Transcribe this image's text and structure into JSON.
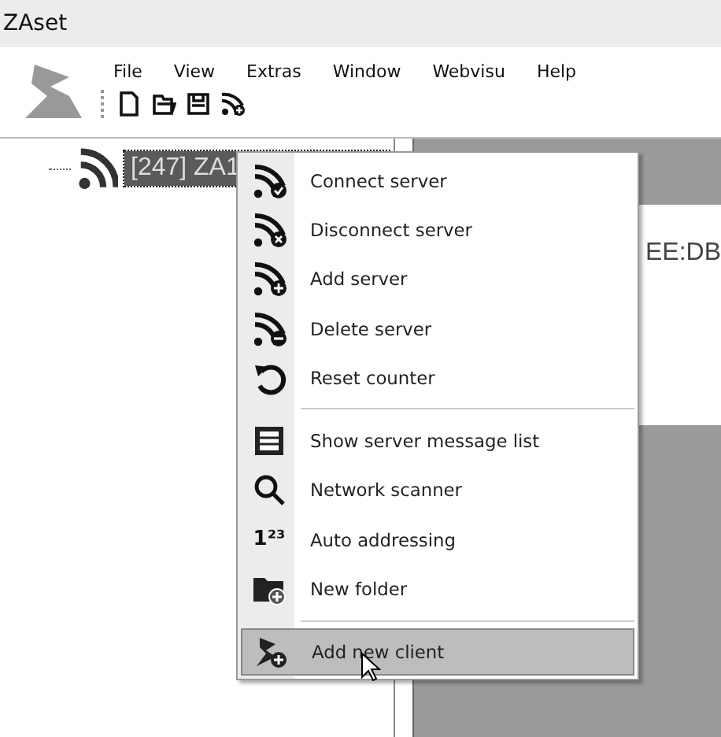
{
  "window": {
    "title": "ZAset"
  },
  "menu_bar": [
    "File",
    "View",
    "Extras",
    "Window",
    "Webvisu",
    "Help"
  ],
  "tree": {
    "items": [
      {
        "label": "[247] ZA1",
        "selected": true
      }
    ]
  },
  "detail": {
    "text": "EE:DB"
  },
  "context_menu": {
    "items": [
      {
        "kind": "item",
        "label": "Connect server",
        "selected": false
      },
      {
        "kind": "item",
        "label": "Disconnect server",
        "selected": false
      },
      {
        "kind": "item",
        "label": "Add server",
        "selected": false
      },
      {
        "kind": "item",
        "label": "Delete server",
        "selected": false
      },
      {
        "kind": "item",
        "label": "Reset counter",
        "selected": false
      },
      {
        "kind": "separator"
      },
      {
        "kind": "item",
        "label": "Show server message list",
        "selected": false
      },
      {
        "kind": "item",
        "label": "Network scanner",
        "selected": false
      },
      {
        "kind": "item",
        "label": "Auto addressing",
        "selected": false,
        "icon_text": "1²³"
      },
      {
        "kind": "item",
        "label": "New folder",
        "selected": false
      },
      {
        "kind": "separator"
      },
      {
        "kind": "item",
        "label": "Add new client",
        "selected": true
      }
    ]
  }
}
